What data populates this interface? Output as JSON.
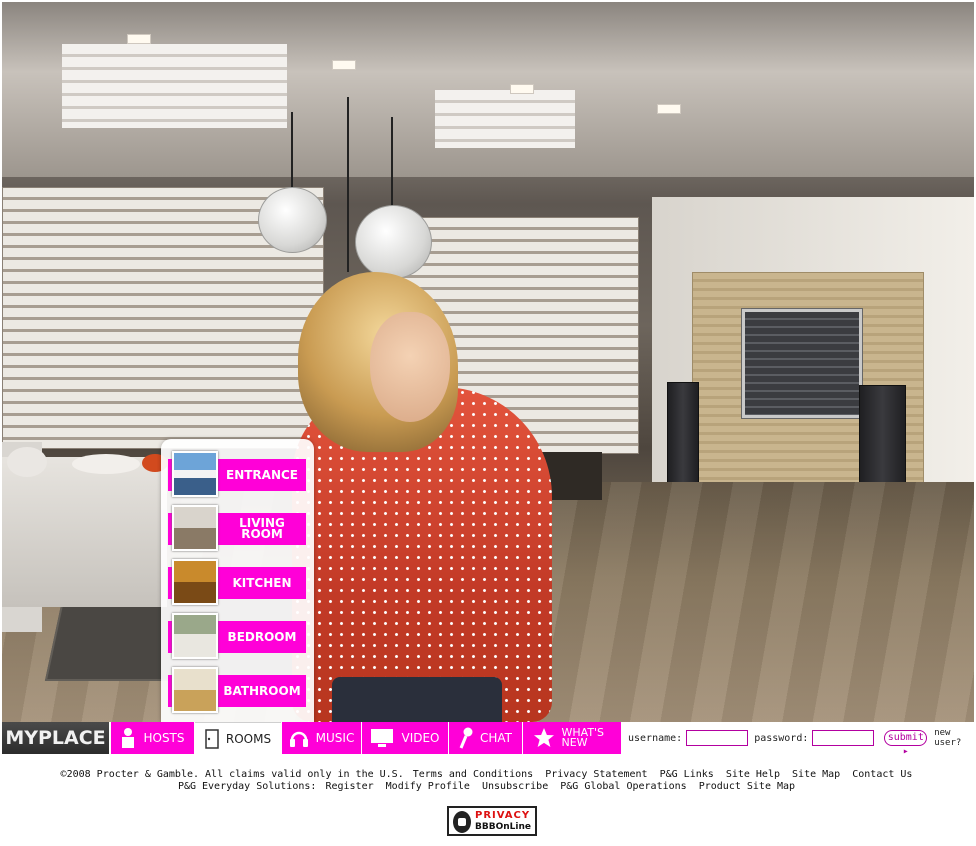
{
  "nav": {
    "logo": "MYPLACE",
    "items": [
      {
        "label": "HOSTS",
        "icon": "person-icon"
      },
      {
        "label": "ROOMS",
        "icon": "door-icon"
      },
      {
        "label": "MUSIC",
        "icon": "headphones-icon"
      },
      {
        "label": "VIDEO",
        "icon": "monitor-icon"
      },
      {
        "label": "CHAT",
        "icon": "microphone-icon"
      },
      {
        "label": "WHAT'S NEW",
        "icon": "star-icon"
      }
    ],
    "active": "ROOMS",
    "accent_color": "#ff00d8"
  },
  "login": {
    "username_label": "username:",
    "password_label": "password:",
    "submit_label": "submit ▸",
    "new_user_label": "new user?"
  },
  "rooms_menu": [
    {
      "label": "ENTRANCE"
    },
    {
      "label": "LIVING ROOM"
    },
    {
      "label": "KITCHEN"
    },
    {
      "label": "BEDROOM"
    },
    {
      "label": "BATHROOM"
    }
  ],
  "footer": {
    "copyright": "©2008 Procter & Gamble. All claims valid only in the U.S.",
    "links_row1": [
      "Terms and Conditions",
      "Privacy Statement",
      "P&G Links",
      "Site Help",
      "Site Map",
      "Contact Us"
    ],
    "row2_label": "P&G Everyday Solutions:",
    "links_row2": [
      "Register",
      "Modify Profile",
      "Unsubscribe",
      "P&G Global Operations",
      "Product Site Map"
    ],
    "badge_top": "PRIVACY",
    "badge_bottom": "BBBOnLine"
  }
}
